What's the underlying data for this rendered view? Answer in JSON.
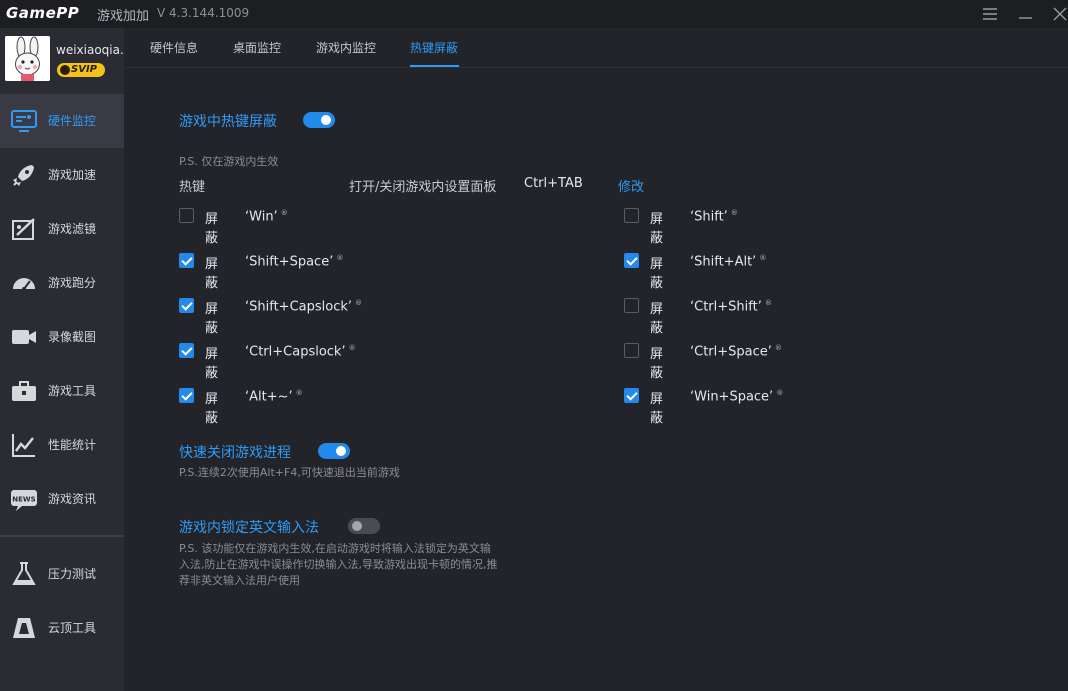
{
  "titlebar": {
    "logo": "GamePP",
    "app_name": "游戏加加",
    "version": "V 4.3.144.1009",
    "menu_icon": "hamburger-icon",
    "minimize_icon": "minimize-icon",
    "close_icon": "close-icon"
  },
  "profile": {
    "username": "weixiaoqia..",
    "badge": "SVIP"
  },
  "sidebar": {
    "items": [
      {
        "label": "硬件监控",
        "icon": "hardware-monitor-icon",
        "active": true
      },
      {
        "label": "游戏加速",
        "icon": "rocket-icon",
        "active": false
      },
      {
        "label": "游戏滤镜",
        "icon": "filter-icon",
        "active": false
      },
      {
        "label": "游戏跑分",
        "icon": "speedometer-icon",
        "active": false
      },
      {
        "label": "录像截图",
        "icon": "video-camera-icon",
        "active": false
      },
      {
        "label": "游戏工具",
        "icon": "toolbox-icon",
        "active": false
      },
      {
        "label": "性能统计",
        "icon": "chart-icon",
        "active": false
      },
      {
        "label": "游戏资讯",
        "icon": "news-icon",
        "active": false
      },
      {
        "label": "压力测试",
        "icon": "flask-icon",
        "active": false
      },
      {
        "label": "云顶工具",
        "icon": "cloud-tool-icon",
        "active": false
      }
    ]
  },
  "tabs": [
    {
      "label": "硬件信息",
      "active": false
    },
    {
      "label": "桌面监控",
      "active": false
    },
    {
      "label": "游戏内监控",
      "active": false
    },
    {
      "label": "热键屏蔽",
      "active": true
    }
  ],
  "hotkey_block": {
    "title": "游戏中热键屏蔽",
    "enabled": true,
    "note": "P.S. 仅在游戏内生效",
    "hotkey_label": "热键",
    "panel_label": "打开/关闭游戏内设置面板",
    "panel_value": "Ctrl+TAB",
    "modify_label": "修改",
    "block_prefix": "屏蔽",
    "left_items": [
      {
        "key": "‘Win’",
        "checked": false
      },
      {
        "key": "‘Shift+Space’",
        "checked": true
      },
      {
        "key": "‘Shift+Capslock’",
        "checked": true
      },
      {
        "key": "‘Ctrl+Capslock’",
        "checked": true
      },
      {
        "key": "‘Alt+~’",
        "checked": true
      }
    ],
    "right_items": [
      {
        "key": "‘Shift’",
        "checked": false
      },
      {
        "key": "‘Shift+Alt’",
        "checked": true
      },
      {
        "key": "‘Ctrl+Shift’",
        "checked": false
      },
      {
        "key": "‘Ctrl+Space’",
        "checked": false
      },
      {
        "key": "‘Win+Space’",
        "checked": true
      }
    ],
    "info_mark": "®"
  },
  "quick_close": {
    "title": "快速关闭游戏进程",
    "enabled": true,
    "note": "P.S.连续2次使用Alt+F4,可快速退出当前游戏"
  },
  "lock_ime": {
    "title": "游戏内锁定英文输入法",
    "enabled": false,
    "note_line1": "P.S. 该功能仅在游戏内生效,在启动游戏时将输入法锁定为英文输",
    "note_line2": "入法,防止在游戏中误操作切换输入法,导致游戏出现卡顿的情况,推",
    "note_line3": "荐非英文输入法用户使用"
  }
}
